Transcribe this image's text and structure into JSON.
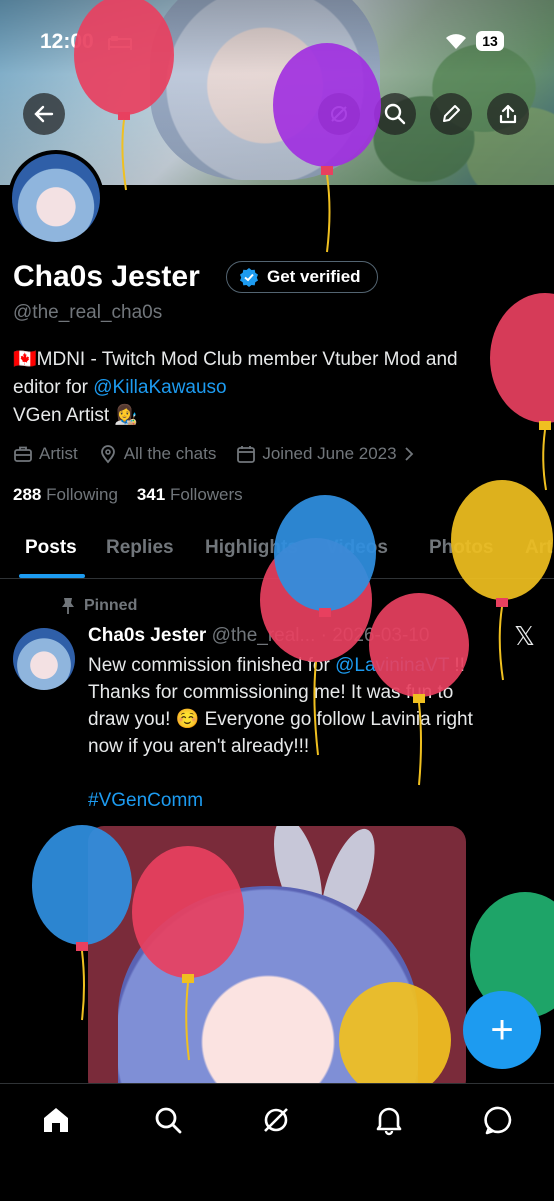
{
  "status_bar": {
    "time": "12:00",
    "battery": "13"
  },
  "profile": {
    "name": "Cha0s Jester",
    "verify_label": "Get verified",
    "handle": "@the_real_cha0s",
    "bio_line1": "🇨🇦MDNI - Twitch Mod Club member Vtuber Mod and",
    "bio_line2_prefix": "editor for ",
    "bio_line2_link": "@KillaKawauso",
    "bio_line3": "VGen Artist 👩‍🎨",
    "category": "Artist",
    "location": "All the chats",
    "joined": "Joined June 2023",
    "following_count": "288",
    "following_label": "Following",
    "followers_count": "341",
    "followers_label": "Followers"
  },
  "tabs": [
    "Posts",
    "Replies",
    "Highlights",
    "Videos",
    "Photos",
    "Art"
  ],
  "post": {
    "pinned_label": "Pinned",
    "author": "Cha0s Jester",
    "meta": "@the_real... · 2026-03-10",
    "line1_prefix": "New commission finished for ",
    "line1_link": "@LavininaVT",
    "line1_suffix": " !!",
    "line2": "Thanks for commissioning me! It was fun to",
    "line3": "draw you! ☺️ Everyone go follow Lavinia right",
    "line4": "now if you aren't already!!!",
    "hashtag": "#VGenComm"
  },
  "fab_label": "+",
  "colors": {
    "accent": "#1d9bf0",
    "balloon_red": "#e8405f",
    "balloon_purple": "#a02ee0",
    "balloon_blue": "#2f8fe0",
    "balloon_yellow": "#f0c020",
    "balloon_green": "#20b070"
  },
  "icons": [
    "back-arrow-icon",
    "grok-icon",
    "search-icon",
    "pencil-icon",
    "share-icon",
    "verified-badge-icon",
    "briefcase-icon",
    "location-pin-icon",
    "calendar-icon",
    "chevron-right-icon",
    "pin-icon",
    "x-logo-icon",
    "home-icon",
    "search-icon",
    "grok-icon",
    "bell-icon",
    "messages-icon"
  ]
}
